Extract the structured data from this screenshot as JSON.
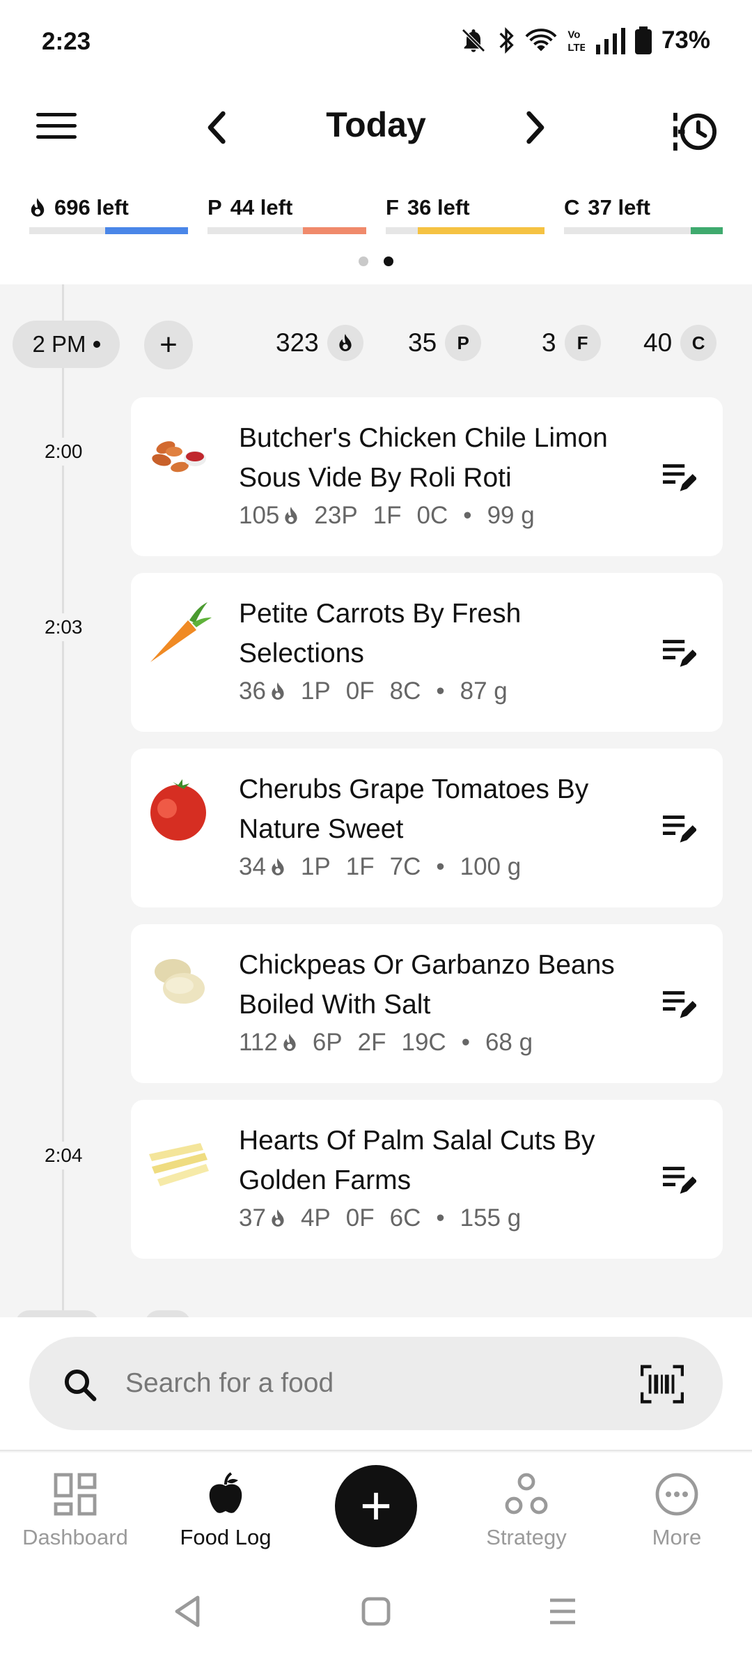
{
  "status": {
    "time": "2:23",
    "battery": "73%"
  },
  "header": {
    "title": "Today"
  },
  "macros": [
    {
      "prefix": "",
      "text": "696 left",
      "color": "#4a86e8",
      "progress": 0.52
    },
    {
      "prefix": "P",
      "text": "44 left",
      "color": "#f08a6b",
      "progress": 0.4
    },
    {
      "prefix": "F",
      "text": "36 left",
      "color": "#f5c242",
      "progress": 0.8
    },
    {
      "prefix": "C",
      "text": "37 left",
      "color": "#3faa6e",
      "progress": 0.2
    }
  ],
  "hour_group": {
    "label": "2 PM",
    "add": "+",
    "calories": "323",
    "protein": "35",
    "fat": "3",
    "carbs": "40",
    "badges": {
      "protein": "P",
      "fat": "F",
      "carbs": "C"
    }
  },
  "entries": [
    {
      "time": "2:00",
      "name": "Butcher's Chicken Chile Limon Sous Vide By Roli Roti",
      "cal": "105",
      "p": "23P",
      "f": "1F",
      "c": "0C",
      "weight": "99 g",
      "icon": "chicken-food-icon"
    },
    {
      "time": "2:03",
      "name": "Petite Carrots By Fresh Selections",
      "cal": "36",
      "p": "1P",
      "f": "0F",
      "c": "8C",
      "weight": "87 g",
      "icon": "carrot-food-icon"
    },
    {
      "time": "",
      "name": "Cherubs Grape Tomatoes By Nature Sweet",
      "cal": "34",
      "p": "1P",
      "f": "1F",
      "c": "7C",
      "weight": "100 g",
      "icon": "tomato-food-icon"
    },
    {
      "time": "",
      "name": "Chickpeas Or Garbanzo Beans Boiled With Salt",
      "cal": "112",
      "p": "6P",
      "f": "2F",
      "c": "19C",
      "weight": "68 g",
      "icon": "chickpea-food-icon"
    },
    {
      "time": "2:04",
      "name": "Hearts Of Palm Salal Cuts By Golden Farms",
      "cal": "37",
      "p": "4P",
      "f": "0F",
      "c": "6C",
      "weight": "155 g",
      "icon": "palm-hearts-food-icon"
    }
  ],
  "search": {
    "placeholder": "Search for a food"
  },
  "nav": {
    "dashboard": "Dashboard",
    "food_log": "Food Log",
    "strategy": "Strategy",
    "more": "More"
  }
}
